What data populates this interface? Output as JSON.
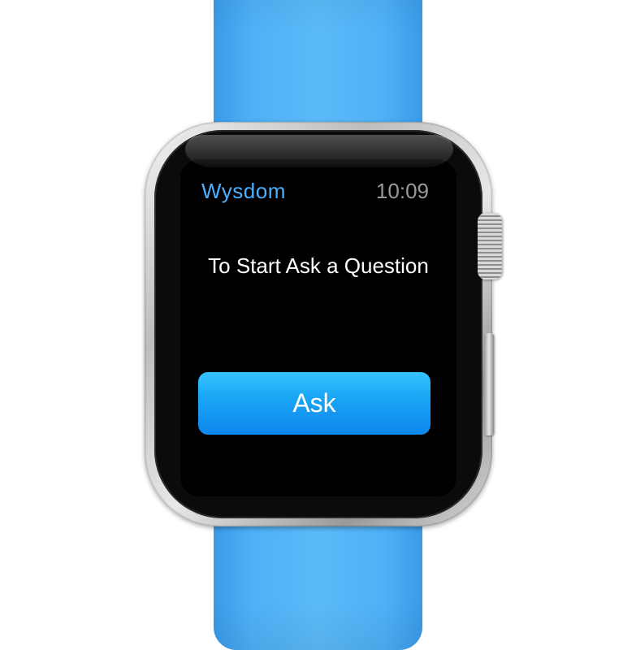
{
  "app": {
    "title": "Wysdom",
    "time": "10:09"
  },
  "main": {
    "prompt": "To Start Ask a Question",
    "ask_button_label": "Ask"
  },
  "colors": {
    "band": "#4fb0f6",
    "accent": "#4ab0ff",
    "button": "#1aa6f5",
    "screen": "#000000"
  },
  "device": {
    "crown_icon": "digital-crown-icon",
    "side_button_icon": "side-button-icon"
  }
}
